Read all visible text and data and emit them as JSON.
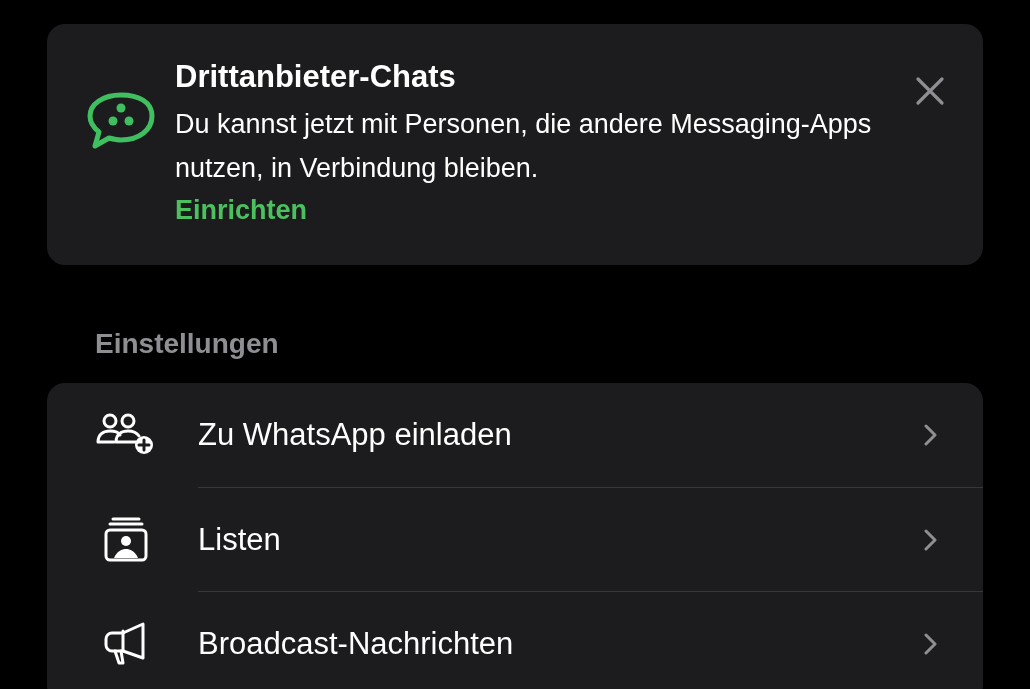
{
  "banner": {
    "title": "Drittanbieter-Chats",
    "text": "Du kannst jetzt mit Personen, die andere Messaging-Apps nutzen, in Verbindung bleiben.",
    "action": "Einrichten"
  },
  "section_header": "Einstellungen",
  "settings": [
    {
      "label": "Zu WhatsApp einladen"
    },
    {
      "label": "Listen"
    },
    {
      "label": "Broadcast-Nachrichten"
    }
  ]
}
